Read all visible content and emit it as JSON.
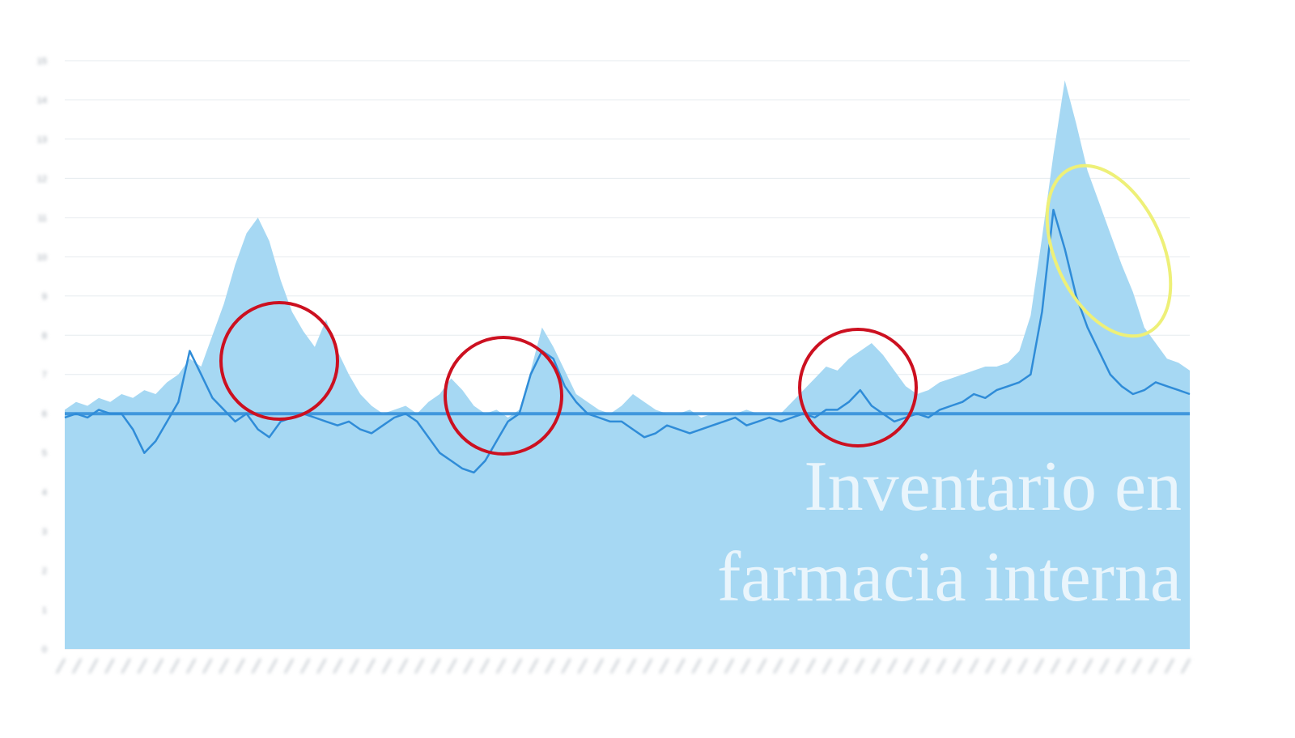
{
  "overlay": {
    "line1": "Inventario en",
    "line2": "farmacia interna"
  },
  "colors": {
    "area": "#a6d8f3",
    "line": "#2f8cd8",
    "grid": "#e6ebef",
    "circle_red": "#cc1020",
    "circle_yellow": "#eef078",
    "axis_text": "#9aa3ad"
  },
  "chart_data": {
    "type": "area",
    "title": "",
    "xlabel": "",
    "ylabel": "",
    "ylim": [
      0,
      15
    ],
    "y_ticks": [
      0,
      1,
      2,
      3,
      4,
      5,
      6,
      7,
      8,
      9,
      10,
      11,
      12,
      13,
      14,
      15
    ],
    "reference_line": 6,
    "series": [
      {
        "kind": "area",
        "values": [
          6.1,
          6.3,
          6.2,
          6.4,
          6.3,
          6.5,
          6.4,
          6.6,
          6.5,
          6.8,
          7.0,
          7.4,
          7.2,
          8.0,
          8.8,
          9.8,
          10.6,
          11.0,
          10.4,
          9.4,
          8.6,
          8.1,
          7.7,
          8.4,
          7.6,
          7.0,
          6.5,
          6.2,
          6.0,
          6.1,
          6.2,
          6.0,
          6.3,
          6.5,
          6.9,
          6.6,
          6.2,
          6.0,
          6.1,
          5.9,
          6.1,
          7.1,
          8.2,
          7.7,
          7.1,
          6.5,
          6.3,
          6.1,
          6.0,
          6.2,
          6.5,
          6.3,
          6.1,
          6.0,
          6.0,
          6.1,
          5.9,
          6.0,
          6.0,
          6.0,
          6.1,
          6.0,
          6.0,
          6.0,
          6.3,
          6.6,
          6.9,
          7.2,
          7.1,
          7.4,
          7.6,
          7.8,
          7.5,
          7.1,
          6.7,
          6.5,
          6.6,
          6.8,
          6.9,
          7.0,
          7.1,
          7.2,
          7.2,
          7.3,
          7.6,
          8.5,
          10.5,
          12.6,
          14.5,
          13.4,
          12.2,
          11.4,
          10.6,
          9.8,
          9.1,
          8.2,
          7.8,
          7.4,
          7.3,
          7.1
        ]
      },
      {
        "kind": "line",
        "values": [
          5.9,
          6.0,
          5.9,
          6.1,
          6.0,
          6.0,
          5.6,
          5.0,
          5.3,
          5.8,
          6.3,
          7.6,
          7.0,
          6.4,
          6.1,
          5.8,
          6.0,
          5.6,
          5.4,
          5.8,
          5.9,
          6.0,
          5.9,
          5.8,
          5.7,
          5.8,
          5.6,
          5.5,
          5.7,
          5.9,
          6.0,
          5.8,
          5.4,
          5.0,
          4.8,
          4.6,
          4.5,
          4.8,
          5.3,
          5.8,
          6.0,
          7.0,
          7.6,
          7.4,
          6.7,
          6.3,
          6.0,
          5.9,
          5.8,
          5.8,
          5.6,
          5.4,
          5.5,
          5.7,
          5.6,
          5.5,
          5.6,
          5.7,
          5.8,
          5.9,
          5.7,
          5.8,
          5.9,
          5.8,
          5.9,
          6.0,
          5.9,
          6.1,
          6.1,
          6.3,
          6.6,
          6.2,
          6.0,
          5.8,
          5.9,
          6.0,
          5.9,
          6.1,
          6.2,
          6.3,
          6.5,
          6.4,
          6.6,
          6.7,
          6.8,
          7.0,
          8.6,
          11.2,
          10.2,
          9.0,
          8.2,
          7.6,
          7.0,
          6.7,
          6.5,
          6.6,
          6.8,
          6.7,
          6.6,
          6.5
        ]
      }
    ]
  }
}
